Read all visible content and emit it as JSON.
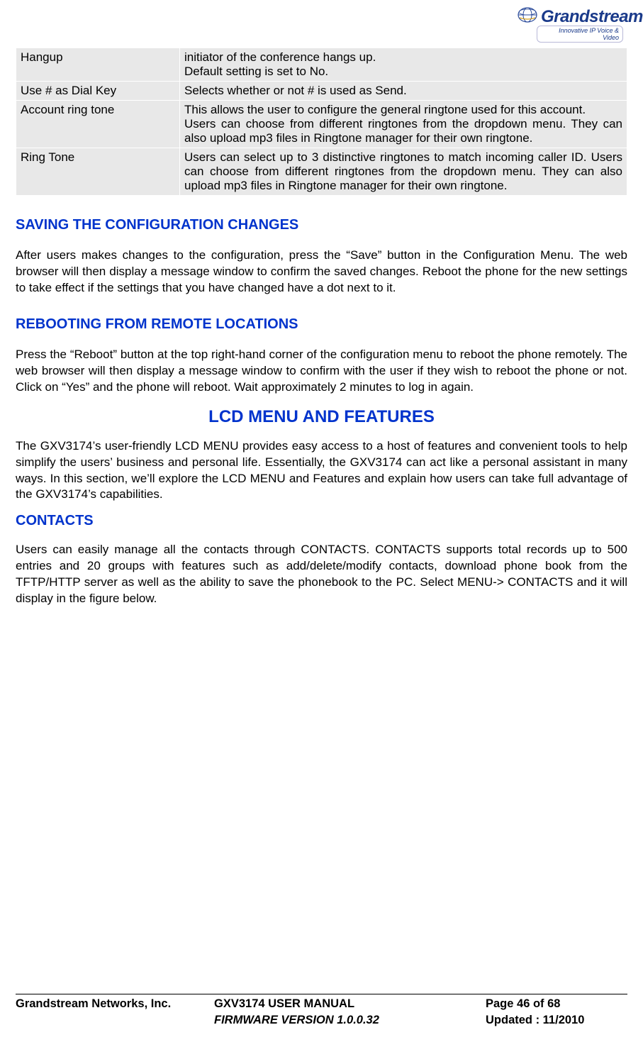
{
  "logo": {
    "brand": "Grandstream",
    "tagline": "Innovative IP Voice & Video"
  },
  "table": {
    "rows": [
      {
        "label": "Hangup",
        "desc": "initiator of the conference hangs up.\nDefault setting is set to No."
      },
      {
        "label": "Use # as Dial Key",
        "desc": "Selects whether or not # is used as Send."
      },
      {
        "label": "Account ring tone",
        "desc": "This allows the user to configure the general ringtone used for this account.\nUsers can choose from different ringtones from the dropdown menu. They can also upload mp3 files in Ringtone manager for their own ringtone."
      },
      {
        "label": "Ring Tone",
        "desc": "Users can select up to 3 distinctive ringtones to match incoming caller ID. Users can choose from different ringtones from the dropdown menu. They can also upload mp3 files in Ringtone manager for their own ringtone."
      }
    ]
  },
  "sections": {
    "saving_heading": "SAVING THE CONFIGURATION CHANGES",
    "saving_body": "After users makes changes to the configuration, press the “Save” button in the Configuration Menu. The web browser will then display a message window to confirm the saved changes. Reboot the phone for the new settings to take effect if the settings that you have changed have a dot next to it.",
    "reboot_heading": "REBOOTING FROM REMOTE LOCATIONS",
    "reboot_body": "Press the “Reboot” button at the top right-hand corner of the configuration menu to reboot the phone remotely. The web browser will then display a message window to confirm with the user if they wish to reboot the phone or not. Click on “Yes” and the phone will reboot. Wait approximately 2 minutes to log in again.",
    "lcd_heading": "LCD MENU AND FEATURES",
    "lcd_body": "The GXV3174’s user-friendly LCD MENU provides easy access to a host of features and convenient tools to help simplify the users’ business and personal life. Essentially, the GXV3174 can act like a personal assistant in many ways. In this section, we’ll explore the LCD MENU and Features and explain how users can take full advantage of the GXV3174’s capabilities.",
    "contacts_heading": "CONTACTS",
    "contacts_body": "Users can easily manage all the contacts through CONTACTS. CONTACTS supports total records up to 500 entries and 20 groups with features such as add/delete/modify contacts, download phone book from the TFTP/HTTP server as well as the ability to save the phonebook to the PC. Select MENU-> CONTACTS and it will display in the figure below."
  },
  "footer": {
    "company": "Grandstream Networks, Inc.",
    "manual": "GXV3174 USER MANUAL",
    "firmware": "FIRMWARE VERSION 1.0.0.32",
    "page": "Page 46 of 68",
    "updated": "Updated : 11/2010"
  }
}
